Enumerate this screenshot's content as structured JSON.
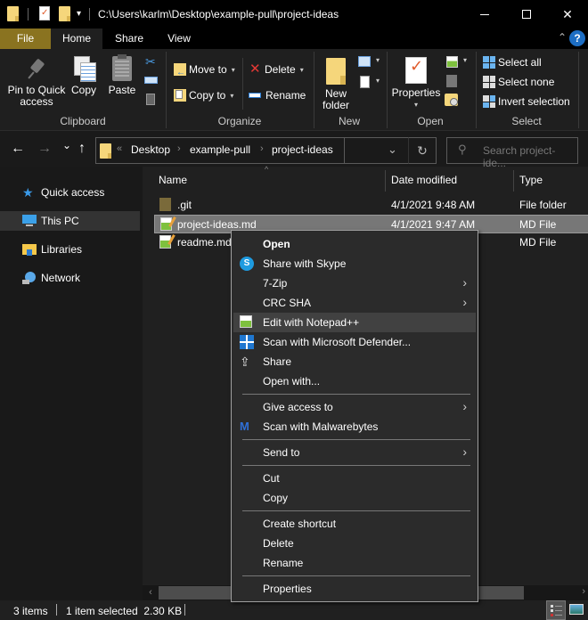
{
  "window": {
    "title": "C:\\Users\\karlm\\Desktop\\example-pull\\project-ideas",
    "minimize_icon": "minimize-icon",
    "maximize_icon": "maximize-icon",
    "close_glyph": "✕"
  },
  "quick_access_toolbar": {
    "dropdown_glyph": "▾"
  },
  "ribbon_tabs": [
    {
      "label": "File"
    },
    {
      "label": "Home"
    },
    {
      "label": "Share"
    },
    {
      "label": "View"
    }
  ],
  "ribbon_extras": {
    "collapse_glyph": "⌃",
    "help_label": "?"
  },
  "ribbon": {
    "clipboard": {
      "label": "Clipboard",
      "pin": "Pin to Quick access",
      "pin_line1": "Pin to Quick",
      "pin_line2": "access",
      "copy": "Copy",
      "paste": "Paste"
    },
    "organize": {
      "label": "Organize",
      "move_to": "Move to",
      "copy_to": "Copy to",
      "delete": "Delete",
      "rename": "Rename"
    },
    "new": {
      "label": "New",
      "new_folder_line1": "New",
      "new_folder_line2": "folder"
    },
    "open": {
      "label": "Open",
      "properties": "Properties"
    },
    "select": {
      "label": "Select",
      "select_all": "Select all",
      "select_none": "Select none",
      "invert_selection": "Invert selection"
    },
    "caret": "▾"
  },
  "navigation": {
    "back": "←",
    "forward": "→",
    "recent": "⌄",
    "up": "↑",
    "overflow": "«",
    "breadcrumb": [
      "Desktop",
      "example-pull",
      "project-ideas"
    ],
    "breadcrumb_sep": "›",
    "dropdown": "⌄",
    "refresh": "↻",
    "search_placeholder": "Search project-ide...",
    "search_glyph": "⚲"
  },
  "sidebar": {
    "items": [
      {
        "label": "Quick access",
        "icon": "star-icon"
      },
      {
        "label": "This PC",
        "icon": "computer-icon",
        "selected": true
      },
      {
        "label": "Libraries",
        "icon": "libraries-icon"
      },
      {
        "label": "Network",
        "icon": "network-icon"
      }
    ]
  },
  "file_list": {
    "columns": [
      "Name",
      "Date modified",
      "Type"
    ],
    "sort_glyph": "^",
    "rows": [
      {
        "name": ".git",
        "date": "4/1/2021 9:48 AM",
        "type": "File folder",
        "icon": "folder-icon"
      },
      {
        "name": "project-ideas.md",
        "date": "4/1/2021 9:47 AM",
        "type": "MD File",
        "icon": "notepad-file-icon",
        "selected": true
      },
      {
        "name": "readme.md",
        "date": "",
        "type": "MD File",
        "icon": "notepad-file-icon"
      }
    ],
    "scroll_left": "‹",
    "scroll_right": "›"
  },
  "context_menu": {
    "submenu_glyph": "›",
    "items": [
      {
        "label": "Open",
        "bold": true
      },
      {
        "label": "Share with Skype",
        "icon": "skype-icon"
      },
      {
        "label": "7-Zip",
        "submenu": true
      },
      {
        "label": "CRC SHA",
        "submenu": true
      },
      {
        "label": "Edit with Notepad++",
        "icon": "notepad-plus-plus-icon",
        "hover": true
      },
      {
        "label": "Scan with Microsoft Defender...",
        "icon": "defender-icon"
      },
      {
        "label": "Share",
        "icon": "share-icon"
      },
      {
        "label": "Open with..."
      },
      {
        "label": "Give access to",
        "submenu": true
      },
      {
        "label": "Scan with Malwarebytes",
        "icon": "malwarebytes-icon"
      },
      {
        "label": "Send to",
        "submenu": true
      },
      {
        "label": "Cut"
      },
      {
        "label": "Copy"
      },
      {
        "label": "Create shortcut"
      },
      {
        "label": "Delete"
      },
      {
        "label": "Rename"
      },
      {
        "label": "Properties"
      }
    ],
    "skype_letter": "S",
    "share_glyph": "⇪",
    "malwarebytes_glyph": "M"
  },
  "status_bar": {
    "item_count": "3 items",
    "selection": "1 item selected  2.30 KB"
  }
}
